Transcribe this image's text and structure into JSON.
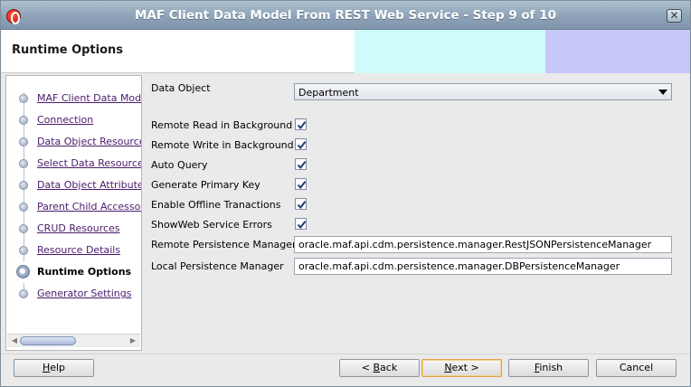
{
  "window": {
    "title": "MAF Client Data Model From REST Web Service - Step 9 of 10",
    "close_label": "✕"
  },
  "header": {
    "page_title": "Runtime Options"
  },
  "nav": {
    "items": [
      {
        "label": "MAF Client Data Model",
        "current": false
      },
      {
        "label": "Connection",
        "current": false
      },
      {
        "label": "Data Object Resources",
        "current": false
      },
      {
        "label": "Select Data Resources",
        "current": false
      },
      {
        "label": "Data Object Attributes",
        "current": false
      },
      {
        "label": "Parent Child Accessors",
        "current": false
      },
      {
        "label": "CRUD Resources",
        "current": false
      },
      {
        "label": "Resource Details",
        "current": false
      },
      {
        "label": "Runtime Options",
        "current": true
      },
      {
        "label": "Generator Settings",
        "current": false
      }
    ]
  },
  "form": {
    "data_object_label": "Data Object",
    "data_object_value": "Department",
    "checkboxes": [
      {
        "label": "Remote Read in Background",
        "checked": true
      },
      {
        "label": "Remote Write in Background",
        "checked": true
      },
      {
        "label": "Auto Query",
        "checked": true
      },
      {
        "label": "Generate Primary Key",
        "checked": true
      },
      {
        "label": "Enable Offline Tranactions",
        "checked": true
      },
      {
        "label": "ShowWeb Service Errors",
        "checked": true
      }
    ],
    "remote_persistence_label": "Remote Persistence Manager",
    "remote_persistence_value": "oracle.maf.api.cdm.persistence.manager.RestJSONPersistenceManager",
    "local_persistence_label": "Local Persistence Manager",
    "local_persistence_value": "oracle.maf.api.cdm.persistence.manager.DBPersistenceManager"
  },
  "buttons": {
    "help": {
      "mnemonic": "H",
      "rest": "elp"
    },
    "back": {
      "prefix": "< ",
      "mnemonic": "B",
      "rest": "ack"
    },
    "next": {
      "mnemonic": "N",
      "rest": "ext >"
    },
    "finish": {
      "mnemonic": "F",
      "rest": "inish"
    },
    "cancel": {
      "mnemonic": "",
      "rest": "Cancel"
    }
  },
  "colors": {
    "header_band_cyan": "#cdfcfa",
    "header_band_lavender": "#c7c7fa",
    "link_color": "#4a1a6b",
    "checkbox_check": "#1f3d6b"
  }
}
